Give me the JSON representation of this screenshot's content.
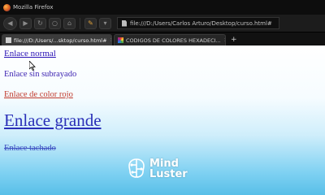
{
  "window": {
    "title": "Mozilla Firefox"
  },
  "navbar": {
    "url": "file:///D:/Users/Carlos Arturo/Desktop/curso.html#"
  },
  "tabs": [
    {
      "label": "file:///D:/Users/...sktop/curso.html#",
      "active": true
    },
    {
      "label": "CODIGOS DE COLORES HEXADECI...",
      "active": false
    }
  ],
  "page": {
    "links": {
      "normal": "Enlace normal",
      "no_underline": "Enlace sin subrayado",
      "red": "Enlace de color rojo",
      "big": "Enlace grande",
      "strikethrough": "Enlace tachado"
    }
  },
  "watermark": {
    "line1": "Mind",
    "line2": "Luster"
  },
  "colors": {
    "link": "#2a12b6",
    "link_red": "#c0392b",
    "content_bottom": "#58bfe8",
    "chrome_dark": "#1c1c1c"
  }
}
